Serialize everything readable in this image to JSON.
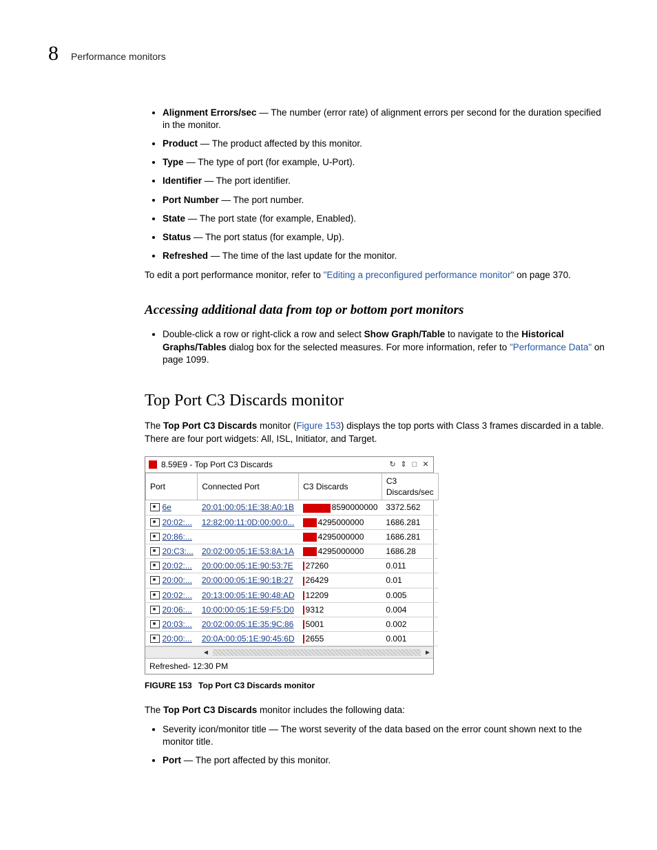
{
  "page": {
    "number": "8",
    "section": "Performance monitors"
  },
  "definitions": [
    {
      "term": "Alignment Errors/sec",
      "desc": " — The number (error rate) of alignment errors per second for the duration specified in the monitor."
    },
    {
      "term": "Product",
      "desc": " — The product affected by this monitor."
    },
    {
      "term": "Type",
      "desc": " — The type of port (for example, U-Port)."
    },
    {
      "term": "Identifier",
      "desc": " — The port identifier."
    },
    {
      "term": "Port Number",
      "desc": " — The port number."
    },
    {
      "term": "State",
      "desc": " — The port state (for example, Enabled)."
    },
    {
      "term": "Status",
      "desc": " — The port status (for example, Up)."
    },
    {
      "term": "Refreshed",
      "desc": " — The time of the last update for the monitor."
    }
  ],
  "edit_para": {
    "prefix": "To edit a port performance monitor, refer to ",
    "link": "\"Editing a preconfigured performance monitor\"",
    "suffix": " on page 370."
  },
  "subheading": "Accessing additional data from top or bottom port monitors",
  "access_bullet": {
    "p1": "Double-click a row or right-click a row and select ",
    "b1": "Show Graph/Table",
    "p2": " to navigate to the ",
    "b2": "Historical Graphs/Tables",
    "p3": " dialog box for the selected measures. For more information, refer to ",
    "link": "\"Performance Data\"",
    "p4": " on page 1099."
  },
  "section_title": "Top Port C3 Discards monitor",
  "intro": {
    "p1": "The ",
    "b1": "Top Port C3 Discards",
    "p2": " monitor (",
    "link": "Figure 153",
    "p3": ") displays the top ports with Class 3 frames discarded in a table. There are four port widgets: All, ISL, Initiator, and Target."
  },
  "widget": {
    "title": "8.59E9 - Top Port C3 Discards",
    "headers": [
      "Port",
      "Connected Port",
      "C3 Discards",
      "C3 Discards/sec"
    ],
    "refreshed": "Refreshed- 12:30 PM"
  },
  "chart_data": {
    "type": "table",
    "columns": [
      "Port",
      "Connected Port",
      "C3 Discards",
      "C3 Discards/sec"
    ],
    "rows": [
      {
        "port": "6e",
        "connected": "20:01:00:05:1E:38:A0:1B",
        "discards_text": "8590000000",
        "bar_pct": 100,
        "discards_sec": "3372.562"
      },
      {
        "port": "20:02:...",
        "connected": "12:82:00:11:0D:00:00:0...",
        "discards_text": "4295000000",
        "bar_pct": 50,
        "discards_sec": "1686.281"
      },
      {
        "port": "20:86:...",
        "connected": "",
        "discards_text": "4295000000",
        "bar_pct": 50,
        "discards_sec": "1686.281"
      },
      {
        "port": "20:C3:...",
        "connected": "20:02:00:05:1E:53:8A:1A",
        "discards_text": "4295000000",
        "bar_pct": 50,
        "discards_sec": "1686.28"
      },
      {
        "port": "20:02:...",
        "connected": "20:00:00:05:1E:90:53:7E",
        "discards_text": "27260",
        "bar_pct": 2,
        "discards_sec": "0.011"
      },
      {
        "port": "20:00:...",
        "connected": "20:00:00:05:1E:90:1B:27",
        "discards_text": "26429",
        "bar_pct": 2,
        "discards_sec": "0.01"
      },
      {
        "port": "20:02:...",
        "connected": "20:13:00:05:1E:90:48:AD",
        "discards_text": "12209",
        "bar_pct": 2,
        "discards_sec": "0.005"
      },
      {
        "port": "20:06:...",
        "connected": "10:00:00:05:1E:59:F5:D0",
        "discards_text": "9312",
        "bar_pct": 2,
        "discards_sec": "0.004"
      },
      {
        "port": "20:03:...",
        "connected": "20:02:00:05:1E:35:9C:86",
        "discards_text": "5001",
        "bar_pct": 2,
        "discards_sec": "0.002"
      },
      {
        "port": "20:00:...",
        "connected": "20:0A:00:05:1E:90:45:6D",
        "discards_text": "2655",
        "bar_pct": 2,
        "discards_sec": "0.001"
      }
    ]
  },
  "figure": {
    "label": "FIGURE 153",
    "text": "Top Port C3 Discards monitor"
  },
  "includes_para": {
    "p1": "The ",
    "b1": "Top Port C3 Discards",
    "p2": " monitor includes the following data:"
  },
  "data_bullets": [
    {
      "term": "",
      "desc": "Severity icon/monitor title — The worst severity of the data based on the error count shown next to the monitor title."
    },
    {
      "term": "Port",
      "desc": " — The port affected by this monitor."
    }
  ]
}
